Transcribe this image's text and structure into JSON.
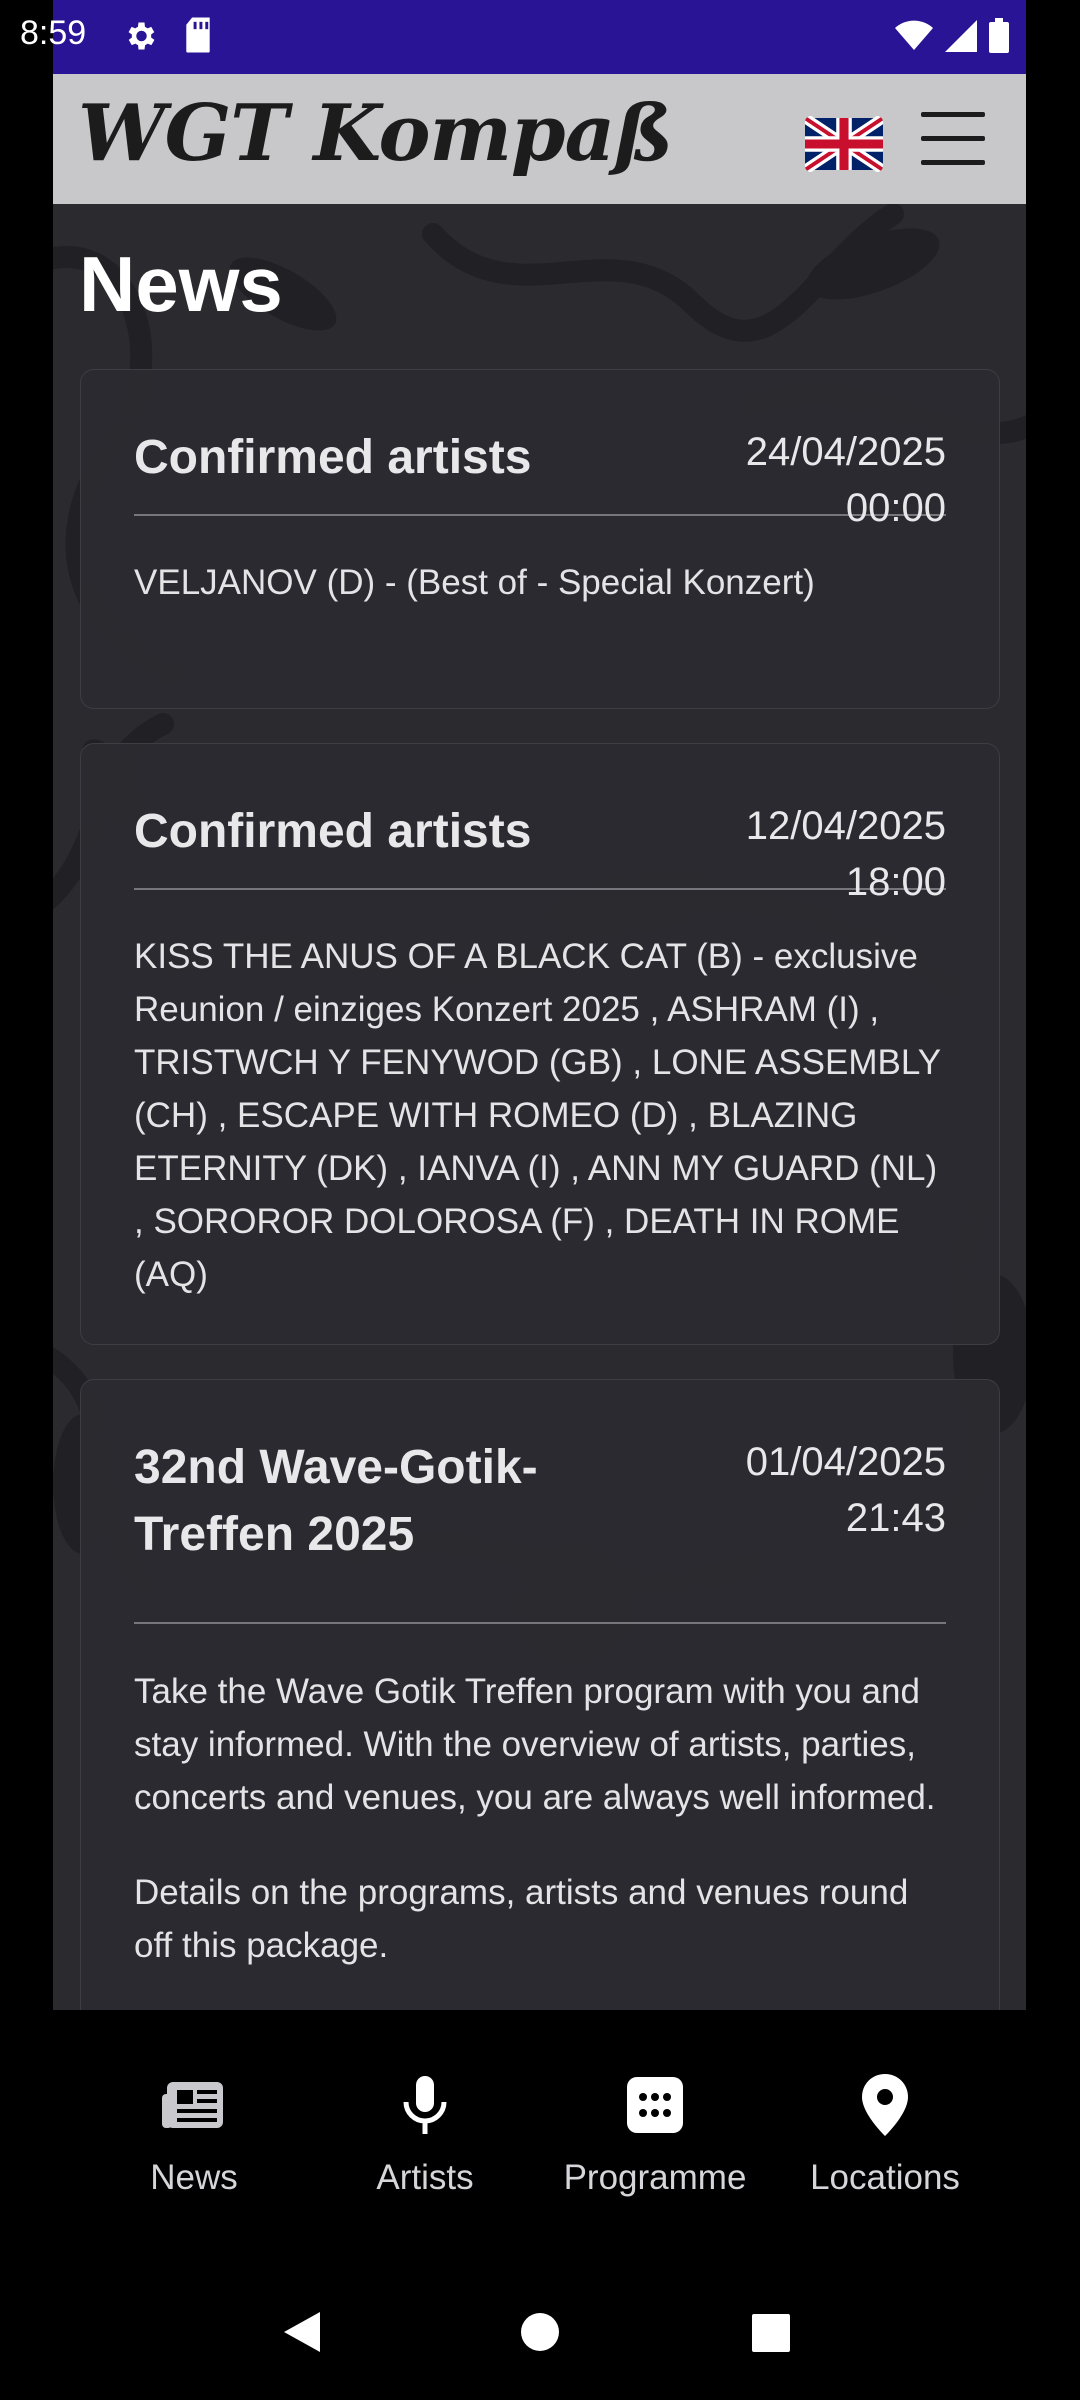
{
  "status_bar": {
    "time": "8:59"
  },
  "header": {
    "logo": "WGT Kompaß",
    "language_icon": "uk-flag-icon",
    "menu_icon": "hamburger-menu-icon"
  },
  "page": {
    "title": "News"
  },
  "news": [
    {
      "title": "Confirmed artists",
      "date": "24/04/2025",
      "time": "00:00",
      "paragraphs": [
        "VELJANOV (D) - (Best of - Special Konzert)"
      ]
    },
    {
      "title": "Confirmed artists",
      "date": "12/04/2025",
      "time": "18:00",
      "paragraphs": [
        "KISS THE ANUS OF A BLACK CAT (B) - exclusive Reunion / einziges Konzert 2025 , ASHRAM (I) , TRISTWCH Y FENYWOD (GB) , LONE ASSEMBLY (CH) , ESCAPE WITH ROMEO (D) , BLAZING ETERNITY (DK) , IANVA (I) , ANN MY GUARD (NL) , SOROROR DOLOROSA (F) , DEATH IN ROME (AQ)"
      ]
    },
    {
      "title": "32nd Wave-Gotik-Treffen 2025",
      "date": "01/04/2025",
      "time": "21:43",
      "paragraphs": [
        "Take the Wave Gotik Treffen program with you and stay informed. With the overview of artists, parties, concerts and venues, you are always well informed.",
        "Details on the programs, artists and venues round off this package."
      ]
    }
  ],
  "bottom_nav": [
    {
      "label": "News",
      "icon": "newspaper-icon"
    },
    {
      "label": "Artists",
      "icon": "microphone-icon"
    },
    {
      "label": "Programme",
      "icon": "calendar-grid-icon"
    },
    {
      "label": "Locations",
      "icon": "map-pin-icon"
    }
  ],
  "system_nav": {
    "back": "back-icon",
    "home": "home-icon",
    "recents": "recents-icon"
  },
  "colors": {
    "status_bar": "#2a1496",
    "header": "#c8c7c9",
    "background": "#2b2a2f"
  }
}
